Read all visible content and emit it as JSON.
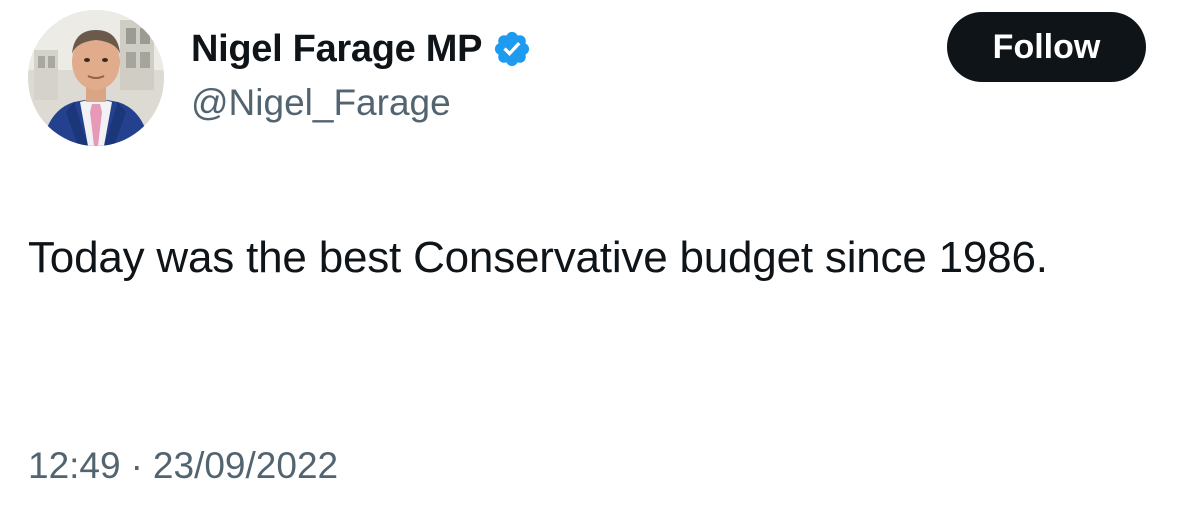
{
  "author": {
    "display_name": "Nigel Farage MP",
    "handle": "@Nigel_Farage",
    "verified_color": "#1d9bf0",
    "avatar_icon": "profile-photo"
  },
  "follow_button": {
    "label": "Follow",
    "background": "#0f1419",
    "text_color": "#ffffff"
  },
  "tweet": {
    "text": "Today was the best Conservative budget since 1986."
  },
  "meta": {
    "time": "12:49",
    "separator": "·",
    "date": "23/09/2022"
  },
  "colors": {
    "primary_text": "#0f1419",
    "secondary_text": "#536471"
  }
}
